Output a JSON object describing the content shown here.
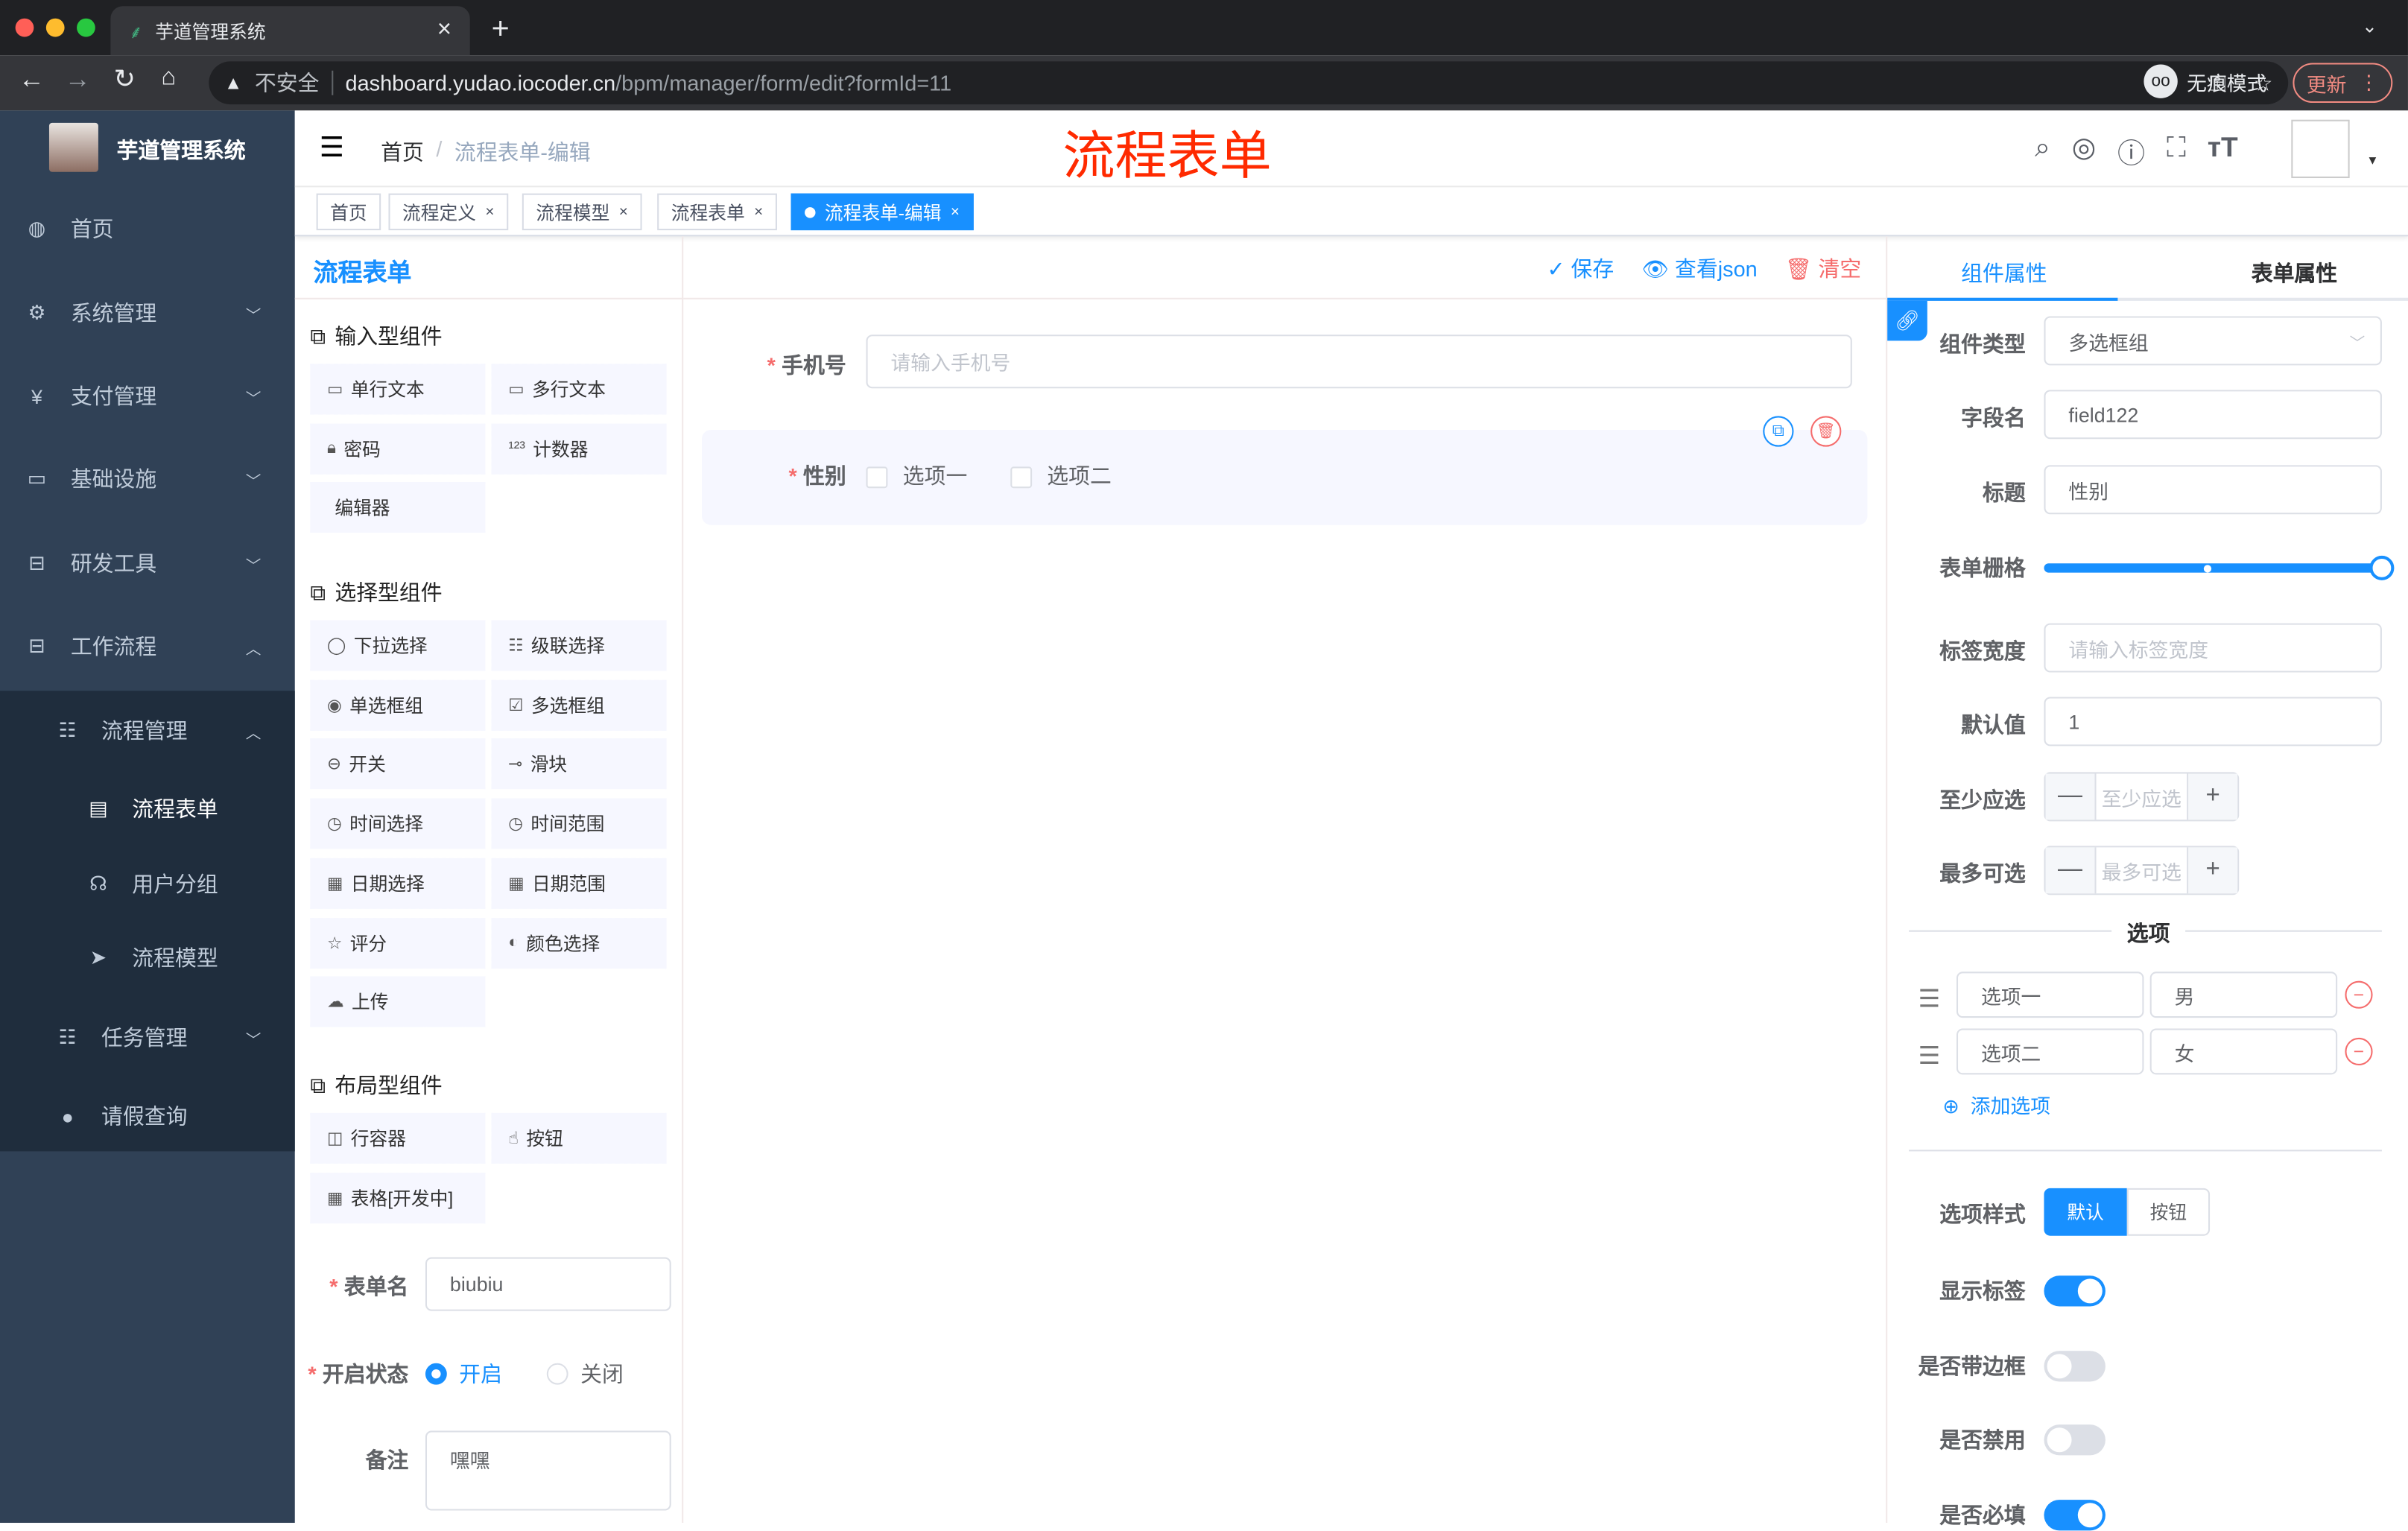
{
  "browser": {
    "tab_title": "芋道管理系统",
    "close": "×",
    "new_tab": "+",
    "insecure": "不安全",
    "url_host": "dashboard.yudao.iocoder.cn",
    "url_path": "/bpm/manager/form/edit?formId=11",
    "incognito": "无痕模式",
    "update": "更新"
  },
  "sidebar": {
    "app_title": "芋道管理系统",
    "items": [
      {
        "label": "首页",
        "icon": "dashboard-icon"
      },
      {
        "label": "系统管理",
        "icon": "gear-icon"
      },
      {
        "label": "支付管理",
        "icon": "yen-icon"
      },
      {
        "label": "基础设施",
        "icon": "monitor-icon"
      },
      {
        "label": "研发工具",
        "icon": "toolbox-icon"
      },
      {
        "label": "工作流程",
        "icon": "toolbox-icon"
      },
      {
        "label": "流程管理",
        "icon": "tree-icon"
      },
      {
        "label": "流程表单",
        "icon": "form-icon"
      },
      {
        "label": "用户分组",
        "icon": "peoples-icon"
      },
      {
        "label": "流程模型",
        "icon": "send-icon"
      },
      {
        "label": "任务管理",
        "icon": "tree-icon"
      },
      {
        "label": "请假查询",
        "icon": "user-icon"
      }
    ]
  },
  "header": {
    "breadcrumb": [
      "首页",
      "流程表单-编辑"
    ],
    "sep": "/",
    "page_title": "流程表单"
  },
  "tags": [
    {
      "label": "首页"
    },
    {
      "label": "流程定义"
    },
    {
      "label": "流程模型"
    },
    {
      "label": "流程表单"
    },
    {
      "label": "流程表单-编辑"
    }
  ],
  "left": {
    "title": "流程表单",
    "groups": [
      {
        "title": "输入型组件",
        "items": [
          "单行文本",
          "多行文本",
          "密码",
          "计数器",
          "编辑器"
        ]
      },
      {
        "title": "选择型组件",
        "items": [
          "下拉选择",
          "级联选择",
          "单选框组",
          "多选框组",
          "开关",
          "滑块",
          "时间选择",
          "时间范围",
          "日期选择",
          "日期范围",
          "评分",
          "颜色选择",
          "上传"
        ]
      },
      {
        "title": "布局型组件",
        "items": [
          "行容器",
          "按钮",
          "表格[开发中]"
        ]
      }
    ],
    "form_name_label": "表单名",
    "form_name": "biubiu",
    "status_label": "开启状态",
    "status_on": "开启",
    "status_off": "关闭",
    "status_value": "开启",
    "remark_label": "备注",
    "remark": "嘿嘿"
  },
  "toolbar": {
    "save": "保存",
    "view_json": "查看json",
    "clear": "清空"
  },
  "canvas": {
    "phone_label": "手机号",
    "phone_placeholder": "请输入手机号",
    "gender_label": "性别",
    "options": [
      "选项一",
      "选项二"
    ]
  },
  "right": {
    "tabs": [
      "组件属性",
      "表单属性"
    ],
    "active_tab": "组件属性",
    "component_type_label": "组件类型",
    "component_type": "多选框组",
    "field_label": "字段名",
    "field": "field122",
    "title_label": "标题",
    "title": "性别",
    "grid_label": "表单栅格",
    "grid_value": 24,
    "grid_max": 24,
    "label_width_label": "标签宽度",
    "label_width_placeholder": "请输入标签宽度",
    "default_label": "默认值",
    "default": "1",
    "min_label": "至少应选",
    "min_placeholder": "至少应选",
    "max_label": "最多可选",
    "max_placeholder": "最多可选",
    "minus": "—",
    "plus": "+",
    "options_divider": "选项",
    "options": [
      {
        "label": "选项一",
        "value": "男"
      },
      {
        "label": "选项二",
        "value": "女"
      }
    ],
    "add_option": "添加选项",
    "style_label": "选项样式",
    "style_options": [
      "默认",
      "按钮"
    ],
    "style_value": "默认",
    "switches": [
      {
        "label": "显示标签",
        "on": true
      },
      {
        "label": "是否带边框",
        "on": false
      },
      {
        "label": "是否禁用",
        "on": false
      },
      {
        "label": "是否必填",
        "on": true
      }
    ]
  },
  "colors": {
    "accent": "#1890ff",
    "sidebar": "#304156",
    "danger": "#f56c6c",
    "title_red": "#ff2a00"
  }
}
